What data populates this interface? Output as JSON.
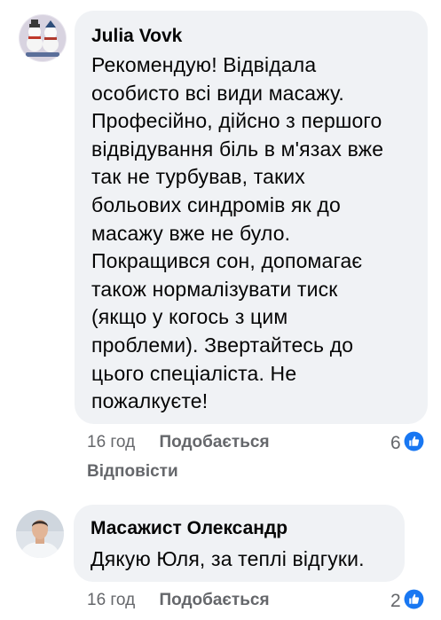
{
  "comments": [
    {
      "author": "Julia Vovk",
      "lines": [
        "Рекомендую! Відвідала",
        "особисто всі види масажу.",
        "Професійно, дійсно з першого",
        "відвідування біль в м'язах вже",
        "так не турбував, таких",
        "больових синдромів як до",
        "масажу вже не було.",
        "Покращився сон, допомагає",
        "також нормалізувати тиск",
        "(якщо у когось з цим",
        "проблеми). Звертайтесь до",
        "цього спеціаліста. Не",
        "пожалкуєте!"
      ],
      "time": "16 год",
      "like_label": "Подобається",
      "reply_label": "Відповісти",
      "reaction_count": "6",
      "reaction_icon": "like-icon"
    },
    {
      "author": "Масажист Олександр",
      "lines": [
        "Дякую Юля, за теплі відгуки."
      ],
      "time": "16 год",
      "like_label": "Подобається",
      "reaction_count": "2",
      "reaction_icon": "like-icon"
    }
  ],
  "colors": {
    "bubble": "#f0f2f5",
    "text": "#050505",
    "secondary": "#65676b",
    "like_blue": "#1877f2"
  }
}
